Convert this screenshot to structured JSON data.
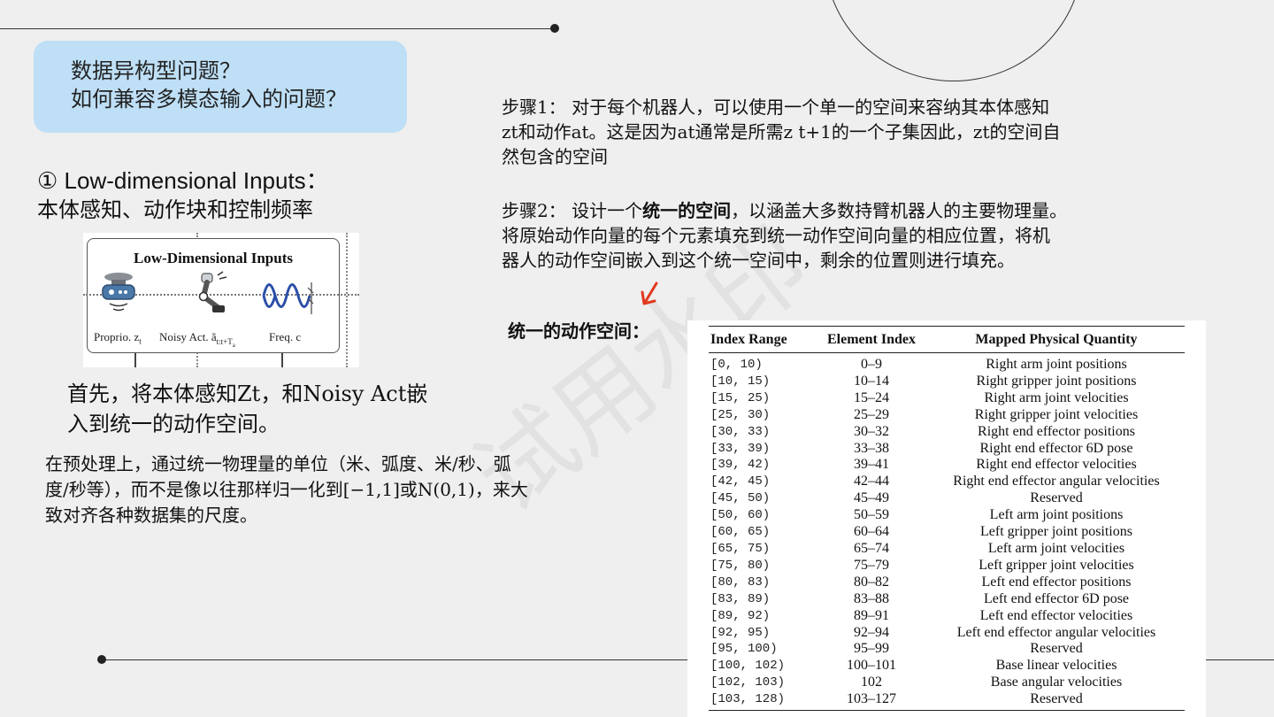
{
  "question": {
    "line1": "数据异构型问题？",
    "line2": "如何兼容多模态输入的问题？"
  },
  "low_dim": {
    "title": "① Low-dimensional Inputs：",
    "subtitle": "本体感知、动作块和控制频率"
  },
  "figure": {
    "title": "Low-Dimensional Inputs",
    "label_proprio": "Proprio. z",
    "label_proprio_sub": "t",
    "label_noisy": "Noisy Act. ã",
    "label_noisy_sub": "t:t+T",
    "label_noisy_subsub": "a",
    "label_freq": "Freq. c"
  },
  "intro": {
    "line1": "首先，将本体感知Zt，和Noisy Act嵌",
    "line2": "入到统一的动作空间。"
  },
  "preprocess": {
    "line1": "在预处理上，通过统一物理量的单位（米、弧度、米/秒、弧",
    "line2": "度/秒等），而不是像以往那样归一化到[−1,1]或N(0,1)，来大",
    "line3": "致对齐各种数据集的尺度。"
  },
  "step1": {
    "line1": "步骤1： 对于每个机器人，可以使用一个单一的空间来容纳其本体感知",
    "line2": "zt和动作at。这是因为at通常是所需z t+1的一个子集因此，zt的空间自",
    "line3": "然包含的空间"
  },
  "step2": {
    "line1_a": "步骤2： 设计一个",
    "line1_bold": "统一的空间",
    "line1_b": "，以涵盖大多数持臂机器人的主要物理量。",
    "line2": "将原始动作向量的每个元素填充到统一动作空间向量的相应位置，将机",
    "line3": "器人的动作空间嵌入到这个统一空间中，剩余的位置则进行填充。"
  },
  "unified_label": "统一的动作空间：",
  "watermark": "试用水印",
  "table": {
    "headers": [
      "Index Range",
      "Element Index",
      "Mapped Physical Quantity"
    ],
    "rows": [
      [
        "[0, 10)",
        "0–9",
        "Right arm joint positions"
      ],
      [
        "[10, 15)",
        "10–14",
        "Right gripper joint positions"
      ],
      [
        "[15, 25)",
        "15–24",
        "Right arm joint velocities"
      ],
      [
        "[25, 30)",
        "25–29",
        "Right gripper joint velocities"
      ],
      [
        "[30, 33)",
        "30–32",
        "Right end effector positions"
      ],
      [
        "[33, 39)",
        "33–38",
        "Right end effector 6D pose"
      ],
      [
        "[39, 42)",
        "39–41",
        "Right end effector velocities"
      ],
      [
        "[42, 45)",
        "42–44",
        "Right end effector angular velocities"
      ],
      [
        "[45, 50)",
        "45–49",
        "Reserved"
      ],
      [
        "[50, 60)",
        "50–59",
        "Left arm joint positions"
      ],
      [
        "[60, 65)",
        "60–64",
        "Left gripper joint positions"
      ],
      [
        "[65, 75)",
        "65–74",
        "Left arm joint velocities"
      ],
      [
        "[75, 80)",
        "75–79",
        "Left gripper joint velocities"
      ],
      [
        "[80, 83)",
        "80–82",
        "Left end effector positions"
      ],
      [
        "[83, 89)",
        "83–88",
        "Left end effector 6D pose"
      ],
      [
        "[89, 92)",
        "89–91",
        "Left end effector velocities"
      ],
      [
        "[92, 95)",
        "92–94",
        "Left end effector angular velocities"
      ],
      [
        "[95, 100)",
        "95–99",
        "Reserved"
      ],
      [
        "[100, 102)",
        "100–101",
        "Base linear velocities"
      ],
      [
        "[102, 103)",
        "102",
        "Base angular velocities"
      ],
      [
        "[103, 128)",
        "103–127",
        "Reserved"
      ]
    ]
  },
  "colors": {
    "background": "#efefef",
    "question_box": "#bedff6",
    "arrow": "#e03a1e"
  }
}
